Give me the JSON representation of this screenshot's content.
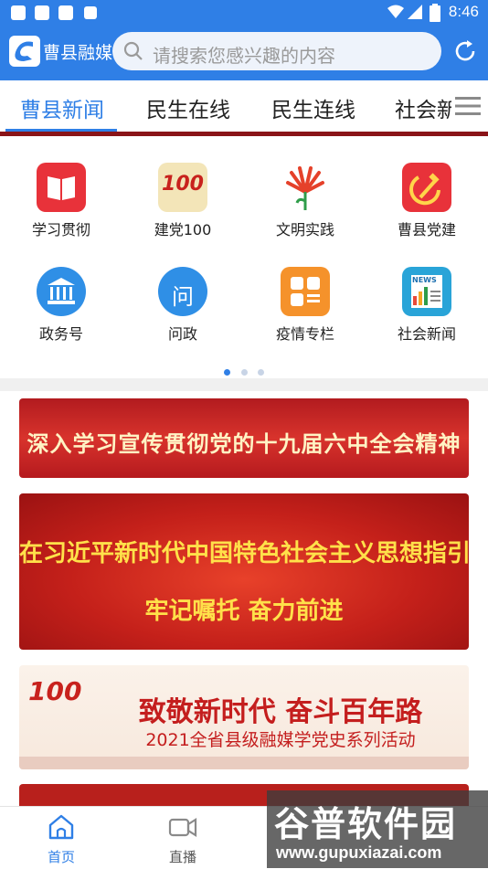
{
  "statusbar": {
    "time": "8:46"
  },
  "header": {
    "app_name": "曹县融媒",
    "search_placeholder": "请搜索您感兴趣的内容"
  },
  "tabs": [
    {
      "label": "曹县新闻"
    },
    {
      "label": "民生在线"
    },
    {
      "label": "民生连线"
    },
    {
      "label": "社会新"
    }
  ],
  "grid": [
    {
      "label": "学习贯彻"
    },
    {
      "label": "建党100",
      "icon_text": "100"
    },
    {
      "label": "文明实践"
    },
    {
      "label": "曹县党建"
    },
    {
      "label": "政务号"
    },
    {
      "label": "问政",
      "icon_text": "问"
    },
    {
      "label": "疫情专栏"
    },
    {
      "label": "社会新闻",
      "icon_text": "NEWS"
    }
  ],
  "banners": [
    {
      "text": "深入学习宣传贯彻党的十九届六中全会精神"
    },
    {
      "line1": "在习近平新时代中国特色社会主义思想指引下",
      "line2": "牢记嘱托  奋力前进"
    },
    {
      "badge": "100",
      "line1": "致敬新时代  奋斗百年路",
      "line2": "2021全省县级融媒学党史系列活动"
    }
  ],
  "bottom_nav": [
    {
      "label": "首页"
    },
    {
      "label": "直播"
    }
  ],
  "watermark": {
    "title": "谷普软件园",
    "url": "www.gupuxiazai.com"
  },
  "colors": {
    "primary": "#2f7fe6",
    "party_red": "#d42a2a"
  }
}
